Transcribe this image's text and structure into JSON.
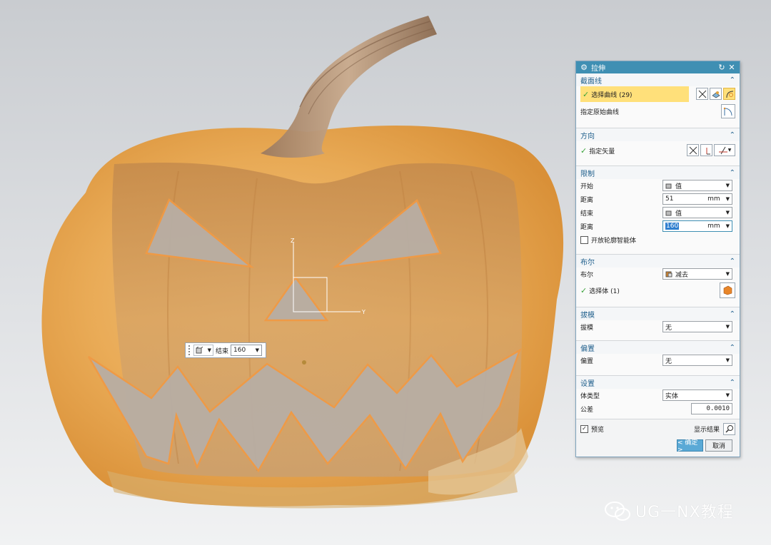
{
  "viewport": {
    "triad": {
      "z_label": "Z",
      "y_label": "Y"
    }
  },
  "mini_toolbar": {
    "label": "结束",
    "value": "160"
  },
  "dialog": {
    "title": "拉伸",
    "sections": {
      "section_curve": {
        "title": "截面线",
        "select_curve": "选择曲线 (29)",
        "specify_origin": "指定原始曲线"
      },
      "direction": {
        "title": "方向",
        "specify_vector": "指定矢量"
      },
      "limits": {
        "title": "限制",
        "start_label": "开始",
        "start_value": "值",
        "start_distance_label": "距离",
        "start_distance": "51",
        "end_label": "结束",
        "end_value": "值",
        "end_distance_label": "距离",
        "end_distance": "160",
        "unit": "mm",
        "open_profile": "开放轮廓智能体"
      },
      "boolean": {
        "title": "布尔",
        "label": "布尔",
        "value": "减去",
        "select_body": "选择体 (1)"
      },
      "draft": {
        "title": "拔模",
        "label": "拔模",
        "value": "无"
      },
      "offset": {
        "title": "偏置",
        "label": "偏置",
        "value": "无"
      },
      "settings": {
        "title": "设置",
        "body_type_label": "体类型",
        "body_type": "实体",
        "tolerance_label": "公差",
        "tolerance": "0.0010"
      }
    },
    "preview_label": "预览",
    "preview_checked": true,
    "show_result": "显示结果",
    "ok": "< 确定 >",
    "cancel": "取消"
  },
  "watermark": "UG一NX教程",
  "colors": {
    "title_bar": "#3f8fb3",
    "section_header": "#1f5f8c",
    "selection_highlight": "#ffe07a",
    "ok_button": "#5aa9d6",
    "pumpkin": "#e8a43c",
    "cut_outline": "#f09a45"
  }
}
